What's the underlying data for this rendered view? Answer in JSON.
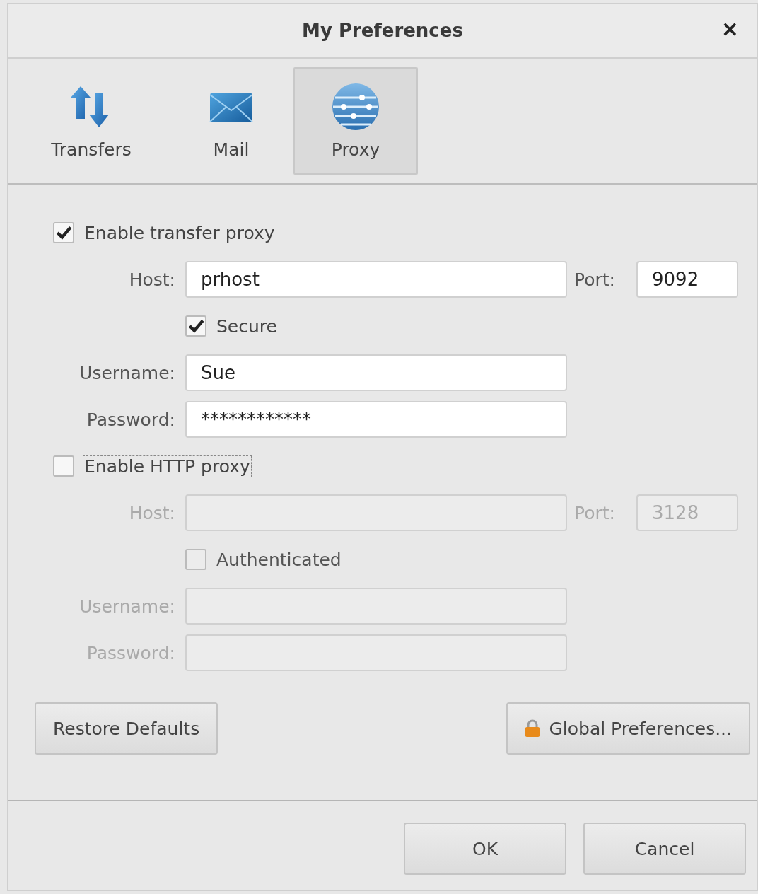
{
  "window": {
    "title": "My Preferences",
    "close": "×"
  },
  "tabs": [
    {
      "label": "Transfers",
      "selected": false
    },
    {
      "label": "Mail",
      "selected": false
    },
    {
      "label": "Proxy",
      "selected": true
    }
  ],
  "sections": [
    {
      "enable": {
        "label": "Enable transfer proxy",
        "checked": true,
        "focused": false
      },
      "host": {
        "label": "Host:",
        "value": "prhost"
      },
      "port": {
        "label": "Port:",
        "value": "9092"
      },
      "option": {
        "label": "Secure",
        "checked": true
      },
      "username": {
        "label": "Username:",
        "value": "Sue"
      },
      "password": {
        "label": "Password:",
        "value": "************"
      }
    },
    {
      "enable": {
        "label": "Enable HTTP proxy",
        "checked": false,
        "focused": true
      },
      "host": {
        "label": "Host:"
      },
      "port": {
        "label": "Port:",
        "value": "3128"
      },
      "option": {
        "label": "Authenticated",
        "checked": false
      },
      "username": {
        "label": "Username:"
      },
      "password": {
        "label": "Password:"
      }
    }
  ],
  "actions": [
    {
      "label": "Restore Defaults",
      "kind": "plain"
    },
    {
      "label": "Global Preferences...",
      "kind": "locked"
    }
  ],
  "footer": [
    "OK",
    "Cancel"
  ]
}
